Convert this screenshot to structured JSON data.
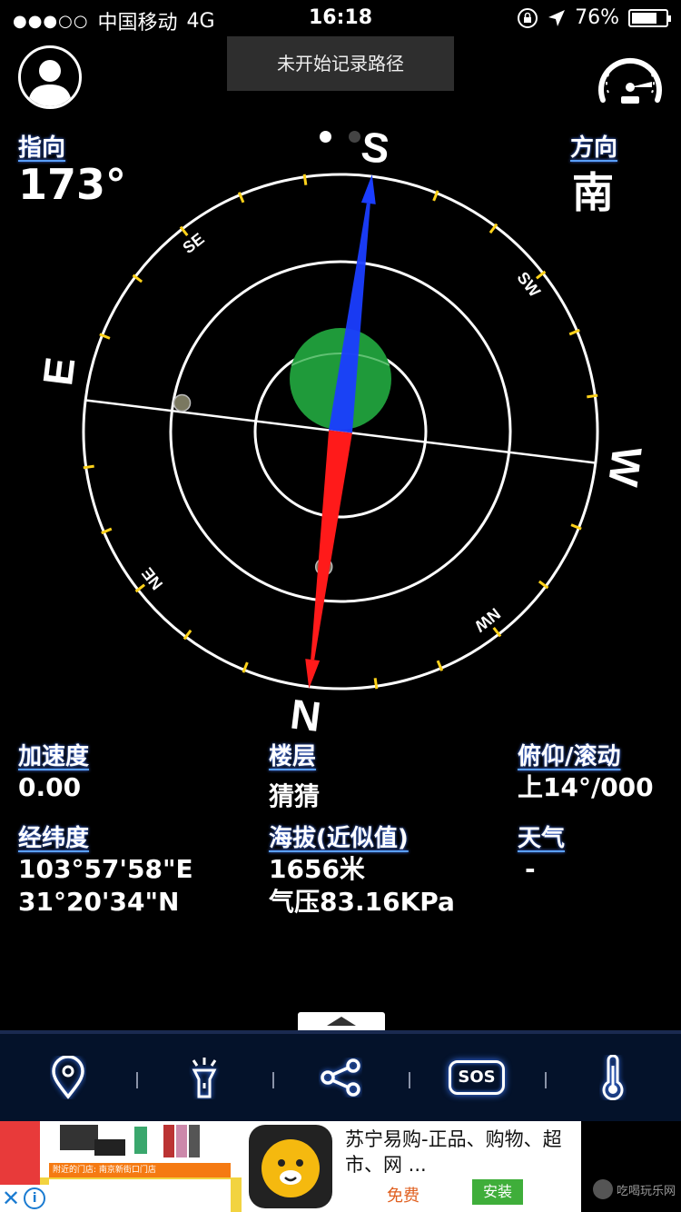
{
  "status_bar": {
    "signal": "●●●○○",
    "carrier": "中国移动",
    "network": "4G",
    "time": "16:18",
    "battery_percent": "76%",
    "battery_level": 0.76,
    "icons": [
      "orientation-lock-icon",
      "location-arrow-icon",
      "battery-icon"
    ]
  },
  "header": {
    "toast": "未开始记录路径",
    "avatar_icon": "user-avatar-icon",
    "speedometer_icon": "speedometer-icon"
  },
  "heading": {
    "label": "指向",
    "value": "173°"
  },
  "direction": {
    "label": "方向",
    "value": "南"
  },
  "pager": {
    "pages": 2,
    "active": 0
  },
  "compass": {
    "heading_deg": 173,
    "cardinals": {
      "N": "N",
      "S": "S",
      "E": "E",
      "W": "W"
    },
    "intercardinals": {
      "SE": "SE",
      "SW": "SW",
      "NE": "NE",
      "NW": "NW"
    },
    "colors": {
      "ring": "#ffffff",
      "tick": "#ffd21a",
      "north_needle": "#ff1a1a",
      "south_needle": "#1a3dff",
      "bubble": "#1f9a3a"
    }
  },
  "info": {
    "acceleration": {
      "label": "加速度",
      "value": "0.00"
    },
    "floor": {
      "label": "楼层",
      "value": "猜猜"
    },
    "pitch_roll": {
      "label": "俯仰/滚动",
      "value": "上14°/000"
    },
    "coordinates": {
      "label": "经纬度",
      "longitude": "103°57'58\"E",
      "latitude": "31°20'34\"N"
    },
    "altitude": {
      "label": "海拔(近似值)",
      "value": "1656米",
      "pressure": "气压83.16KPa"
    },
    "weather": {
      "label": "天气",
      "value": "-"
    }
  },
  "toolbar": {
    "items": [
      {
        "icon": "map-pin-icon"
      },
      {
        "icon": "flashlight-icon"
      },
      {
        "icon": "share-icon"
      },
      {
        "icon": "sos-icon",
        "label": "SOS"
      },
      {
        "icon": "thermometer-icon"
      }
    ]
  },
  "ad": {
    "banner_strip": "附近的门店: 南京新街口门店",
    "title": "苏宁易购-正品、购物、超市、网 ...",
    "free": "免费",
    "install": "安装",
    "watermark": "吃喝玩乐网"
  }
}
